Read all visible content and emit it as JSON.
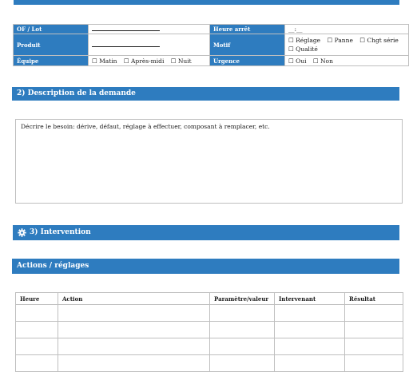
{
  "sections": {
    "top_title": "",
    "description_title": "2) Description de la demande",
    "intervention_title": "3) Intervention",
    "actions_title": "Actions / réglages"
  },
  "info_table": {
    "of_lot_label": "OF / Lot",
    "heure_arret_label": "Heure arrêt",
    "heure_arret_value": "__:__",
    "produit_label": "Produit",
    "motif_label": "Motif",
    "motif_options": [
      "☐ Réglage",
      "☐ Panne",
      "☐ Chgt série",
      "☐ Qualité"
    ],
    "equipe_label": "Équipe",
    "equipe_options": [
      "☐ Matin",
      "☐ Après-midi",
      "☐ Nuit"
    ],
    "urgence_label": "Urgence",
    "urgence_options": [
      "☐ Oui",
      "☐ Non"
    ]
  },
  "description": {
    "placeholder": "Décrire le besoin: dérive, défaut, réglage à effectuer, composant à remplacer, etc."
  },
  "actions_table": {
    "headers": [
      "Heure",
      "Action",
      "Paramètre/valeur",
      "Intervenant",
      "Résultat"
    ],
    "rows": [
      [
        "",
        "",
        "",
        "",
        ""
      ],
      [
        "",
        "",
        "",
        "",
        ""
      ],
      [
        "",
        "",
        "",
        "",
        ""
      ],
      [
        "",
        "",
        "",
        "",
        ""
      ]
    ]
  },
  "colors": {
    "accent": "#2e7cbf",
    "border": "#bfbfbf"
  },
  "icons": {
    "intervention": "gear-icon"
  }
}
